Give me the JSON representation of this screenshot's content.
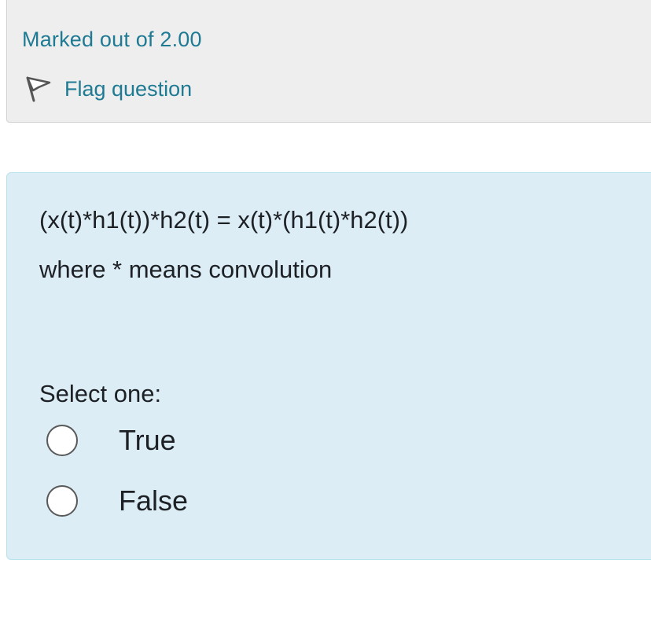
{
  "info": {
    "marked_out": "Marked out of 2.00",
    "flag_label": "Flag question",
    "flag_icon": "flag-icon"
  },
  "question": {
    "line1": "(x(t)*h1(t))*h2(t) = x(t)*(h1(t)*h2(t))",
    "line2": "where * means convolution",
    "prompt": "Select one:",
    "options": [
      {
        "label": "True",
        "selected": false
      },
      {
        "label": "False",
        "selected": false
      }
    ]
  },
  "colors": {
    "link": "#1f7a93",
    "question_bg": "#dcedf5",
    "info_bg": "#eeeeee",
    "text": "#1d2125"
  }
}
